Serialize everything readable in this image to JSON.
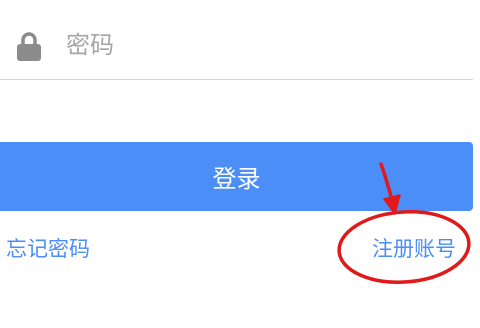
{
  "login_form": {
    "password_placeholder": "密码",
    "password_value": "",
    "login_button_label": "登录",
    "forgot_password_label": "忘记密码",
    "register_label": "注册账号"
  },
  "icons": {
    "lock": "lock-icon"
  },
  "colors": {
    "brand_blue": "#4c8ef7",
    "placeholder_gray": "#a6a6a6",
    "icon_gray": "#8c8c8c",
    "annotation_red": "#e01a1a"
  }
}
